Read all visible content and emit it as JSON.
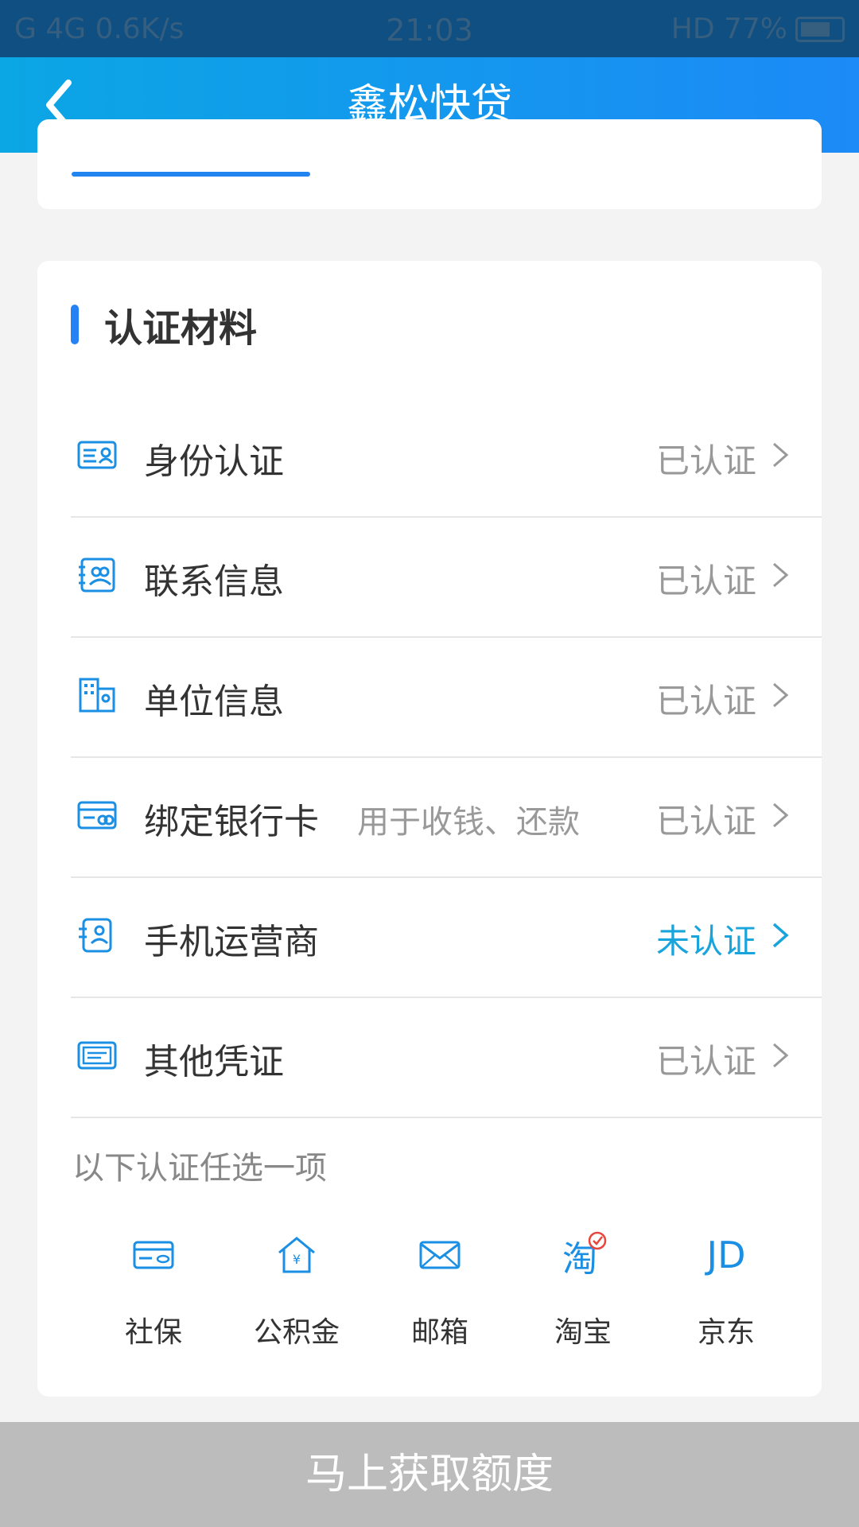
{
  "status_bar": {
    "left": "G  4G  0.6K/s",
    "time": "21:03",
    "right": "HD 77%"
  },
  "header": {
    "title": "鑫松快贷"
  },
  "section": {
    "title": "认证材料"
  },
  "items": [
    {
      "label": "身份认证",
      "sub": "",
      "status": "已认证",
      "icon": "id-card-icon"
    },
    {
      "label": "联系信息",
      "sub": "",
      "status": "已认证",
      "icon": "contacts-icon"
    },
    {
      "label": "单位信息",
      "sub": "",
      "status": "已认证",
      "icon": "building-icon"
    },
    {
      "label": "绑定银行卡",
      "sub": "用于收钱、还款",
      "status": "已认证",
      "icon": "bank-card-icon"
    },
    {
      "label": "手机运营商",
      "sub": "",
      "status": "未认证",
      "icon": "mobile-icon"
    },
    {
      "label": "其他凭证",
      "sub": "",
      "status": "已认证",
      "icon": "document-icon"
    }
  ],
  "options_hint": "以下认证任选一项",
  "options": [
    {
      "label": "社保",
      "icon": "social-security-icon"
    },
    {
      "label": "公积金",
      "icon": "housing-fund-icon"
    },
    {
      "label": "邮箱",
      "icon": "mail-icon"
    },
    {
      "label": "淘宝",
      "icon": "taobao-icon",
      "icon_text": "淘"
    },
    {
      "label": "京东",
      "icon": "jd-icon",
      "icon_text": "JD"
    }
  ],
  "cta": {
    "label": "马上获取额度"
  },
  "colors": {
    "accent": "#2284f0",
    "verified": "#999999",
    "unverified": "#1aa4dc",
    "cta_bg": "#bcbcbc"
  }
}
